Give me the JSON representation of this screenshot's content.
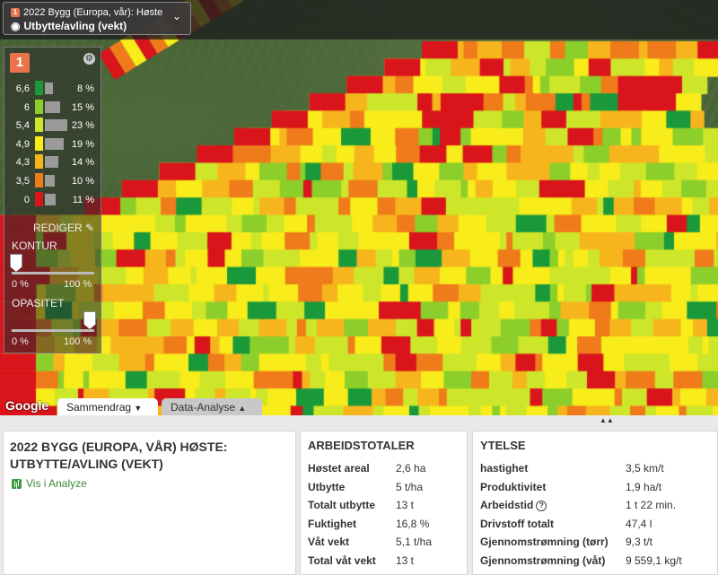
{
  "header": {
    "badge": "1",
    "title_line1": "2022 Bygg (Europa, vår): Høste",
    "title_line2": "Utbytte/avling (vekt)"
  },
  "legend": {
    "badge": "1",
    "rows": [
      {
        "label": "6,6",
        "pct": "8 %",
        "color": "#19993a",
        "share": 8
      },
      {
        "label": "6",
        "pct": "15 %",
        "color": "#8ccf2a",
        "share": 15
      },
      {
        "label": "5,4",
        "pct": "23 %",
        "color": "#cde62a",
        "share": 23
      },
      {
        "label": "4,9",
        "pct": "19 %",
        "color": "#f8ec1a",
        "share": 19
      },
      {
        "label": "4,3",
        "pct": "14 %",
        "color": "#f7b51d",
        "share": 14
      },
      {
        "label": "3,5",
        "pct": "10 %",
        "color": "#ef7b1a",
        "share": 10
      },
      {
        "label": "0",
        "pct": "11 %",
        "color": "#d9141b",
        "share": 11
      }
    ],
    "edit_label": "REDIGER",
    "contour": {
      "title": "KONTUR",
      "min": "0 %",
      "max": "100 %",
      "value": 0
    },
    "opacity": {
      "title": "OPASITET",
      "min": "0 %",
      "max": "100 %",
      "value": 1
    }
  },
  "map": {
    "provider": "Google",
    "tabs": [
      {
        "label": "Sammendrag",
        "active": true,
        "arrow": "▼"
      },
      {
        "label": "Data-Analyse",
        "active": false,
        "arrow": "▲"
      }
    ]
  },
  "summary": {
    "title": "2022 BYGG (EUROPA, VÅR) HØSTE: UTBYTTE/AVLING (VEKT)",
    "link": "Vis i Analyze"
  },
  "work_totals": {
    "title": "ARBEIDSTOTALER",
    "rows": [
      {
        "k": "Høstet areal",
        "v": "2,6 ha"
      },
      {
        "k": "Utbytte",
        "v": "5 t/ha"
      },
      {
        "k": "Totalt utbytte",
        "v": "13 t"
      },
      {
        "k": "Fuktighet",
        "v": "16,8 %"
      },
      {
        "k": "Våt vekt",
        "v": "5,1 t/ha"
      },
      {
        "k": "Total våt vekt",
        "v": "13 t"
      }
    ]
  },
  "performance": {
    "title": "YTELSE",
    "rows": [
      {
        "k": "hastighet",
        "v": "3,5 km/t"
      },
      {
        "k": "Produktivitet",
        "v": "1,9 ha/t"
      },
      {
        "k": "Arbeidstid",
        "v": "1 t 22 min."
      },
      {
        "k": "Drivstoff totalt",
        "v": "47,4 l"
      },
      {
        "k": "Gjennomstrømning (tørr)",
        "v": "9,3 t/t"
      },
      {
        "k": "Gjennomstrømning (våt)",
        "v": "9 559,1 kg/t"
      }
    ]
  }
}
